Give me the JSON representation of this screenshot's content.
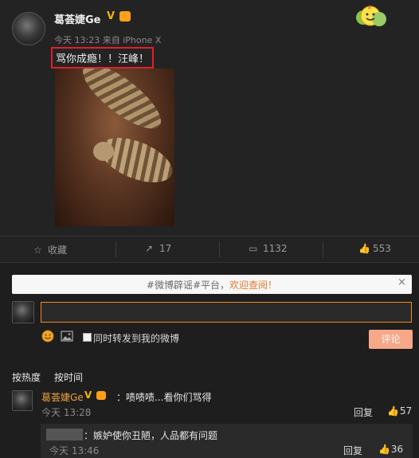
{
  "post": {
    "username": "葛荟婕Ge",
    "verified_badge": "V",
    "meta": "今天 13:23 来自 iPhone X",
    "text": "骂你成瘾！！汪峰！",
    "image_icon": "cat-photo",
    "sticker_icon": "sunflower-sticker-icon"
  },
  "actions": {
    "favorite": "收藏",
    "repost_count": "17",
    "comment_count": "1132",
    "like_count": "553"
  },
  "banner": {
    "prefix": "#微博辟谣#平台，",
    "accent": "欢迎查阅！",
    "close": "×",
    "accent_color": "#e27a2e"
  },
  "composer": {
    "input_value": "",
    "forward_label": "同时转发到我的微博",
    "submit_label": "评论"
  },
  "sort": {
    "by_hot": "按热度",
    "by_time": "按时间"
  },
  "comments": [
    {
      "username": "葛荟婕Ge",
      "badge": "V",
      "text": "：啧啧啧...看你们骂得",
      "time": "今天 13:28",
      "reply": "回复",
      "likes": "57"
    }
  ],
  "sub_comment": {
    "text": "：嫉妒使你丑陋，人品都有问题",
    "time": "今天 13:46",
    "reply": "回复",
    "likes": "36"
  }
}
